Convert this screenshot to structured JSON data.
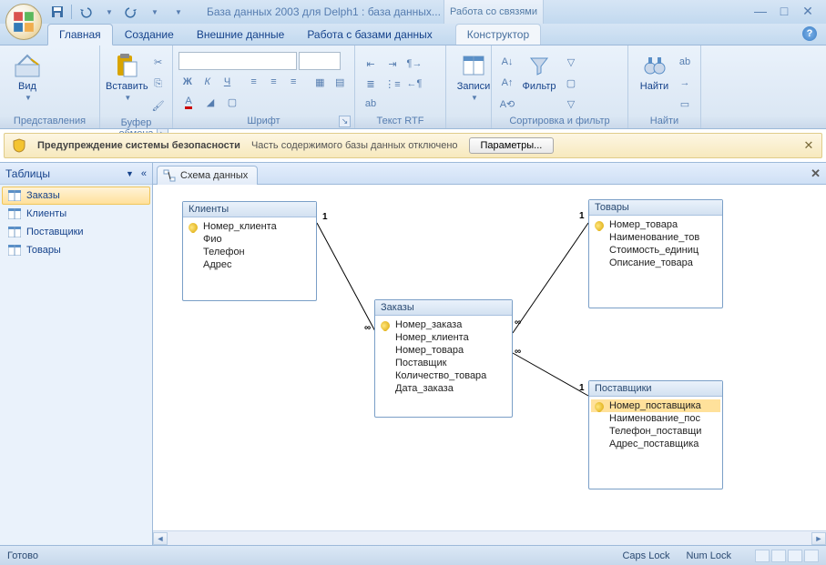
{
  "title": "База данных 2003 для Delph1 : база данных...",
  "contextual_tab_group": "Работа со связями",
  "ribbon_tabs": [
    "Главная",
    "Создание",
    "Внешние данные",
    "Работа с базами данных",
    "Конструктор"
  ],
  "ribbon_groups": {
    "view": "Вид",
    "views_group": "Представления",
    "paste": "Вставить",
    "clipboard": "Буфер обмена",
    "font": "Шрифт",
    "richtext": "Текст RTF",
    "records": "Записи",
    "sortfilter": "Сортировка и фильтр",
    "filter": "Фильтр",
    "find": "Найти",
    "find_group": "Найти"
  },
  "security": {
    "title": "Предупреждение системы безопасности",
    "message": "Часть содержимого базы данных отключено",
    "button": "Параметры..."
  },
  "nav": {
    "header": "Таблицы",
    "items": [
      "Заказы",
      "Клиенты",
      "Поставщики",
      "Товары"
    ]
  },
  "doc_tab": "Схема данных",
  "tables": {
    "clients": {
      "title": "Клиенты",
      "fields": [
        "Номер_клиента",
        "Фио",
        "Телефон",
        "Адрес"
      ],
      "pk": [
        0
      ]
    },
    "orders": {
      "title": "Заказы",
      "fields": [
        "Номер_заказа",
        "Номер_клиента",
        "Номер_товара",
        "Поставщик",
        "Количество_товара",
        "Дата_заказа"
      ],
      "pk": [
        0
      ]
    },
    "goods": {
      "title": "Товары",
      "fields": [
        "Номер_товара",
        "Наименование_тов",
        "Стоимость_единиц",
        "Описание_товара"
      ],
      "pk": [
        0
      ]
    },
    "suppliers": {
      "title": "Поставщики",
      "fields": [
        "Номер_поставщика",
        "Наименование_пос",
        "Телефон_поставщи",
        "Адрес_поставщика"
      ],
      "pk": [
        0
      ]
    }
  },
  "rel_labels": {
    "one": "1",
    "many": "∞"
  },
  "status": {
    "ready": "Готово",
    "caps": "Caps Lock",
    "num": "Num Lock"
  }
}
